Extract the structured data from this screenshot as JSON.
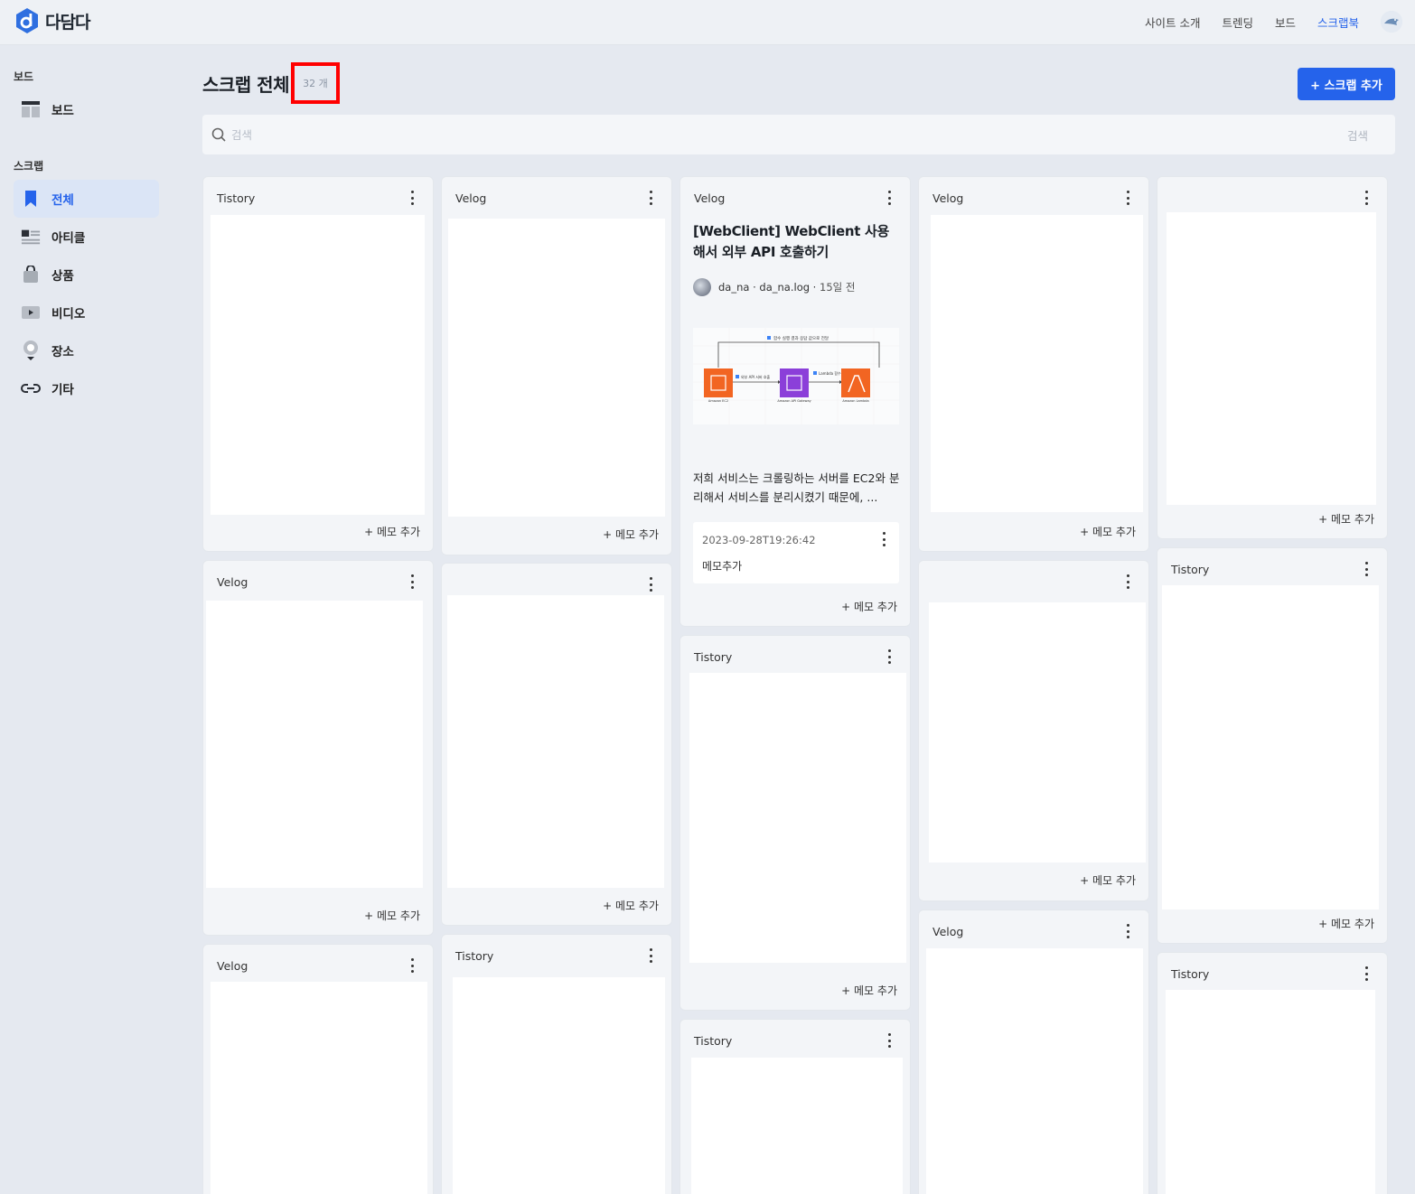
{
  "header": {
    "logo_text": "다담다",
    "nav": [
      "사이트 소개",
      "트렌딩",
      "보드",
      "스크랩북"
    ],
    "active_nav": "스크랩북"
  },
  "sidebar": {
    "board_section": "보드",
    "board_item": "보드",
    "scrap_section": "스크랩",
    "items": [
      "전체",
      "아티클",
      "상품",
      "비디오",
      "장소",
      "기타"
    ]
  },
  "main": {
    "title": "스크랩 전체",
    "count": "32 개",
    "add_button": "+ 스크랩 추가",
    "search_placeholder": "검색",
    "search_button": "검색"
  },
  "cards": [
    {
      "source": "Tistory",
      "memo_add": "+ 메모 추가"
    },
    {
      "source": "Velog",
      "memo_add": "+ 메모 추가"
    },
    {
      "source": "Velog",
      "title": "[WebClient] WebClient 사용해서 외부 API 호출하기",
      "author": "da_na",
      "blog": "da_na.log",
      "time": "15일 전",
      "excerpt": "저희 서비스는 크롤링하는 서버를 EC2와 분리해서 서비스를 분리시켰기 때문에, ...",
      "memo_date": "2023-09-28T19:26:42",
      "memo_text": "메모추가",
      "memo_add": "+ 메모 추가",
      "diagram": {
        "top_label": "함수 실행 결과 응답 값으로 전달",
        "mid_label1": "외부 API 서버 호출",
        "mid_label2": "Lambda 함수 실행",
        "node1": "Amazon EC2",
        "node2": "Amazon API Gateway",
        "node3": "Amazon Lambda"
      }
    },
    {
      "source": "Velog",
      "memo_add": "+ 메모 추가"
    },
    {
      "source": "",
      "memo_add": "+ 메모 추가"
    },
    {
      "source": "Velog",
      "memo_add": "+ 메모 추가"
    },
    {
      "source": "",
      "memo_add": "+ 메모 추가"
    },
    {
      "source": "Tistory",
      "memo_add": "+ 메모 추가"
    },
    {
      "source": "",
      "memo_add": "+ 메모 추가"
    },
    {
      "source": "Tistory",
      "memo_add": "+ 메모 추가"
    },
    {
      "source": "Velog",
      "memo_add": ""
    },
    {
      "source": "Tistory",
      "memo_add": ""
    },
    {
      "source": "Tistory",
      "memo_add": ""
    },
    {
      "source": "Velog",
      "memo_add": ""
    },
    {
      "source": "Tistory",
      "memo_add": ""
    }
  ]
}
